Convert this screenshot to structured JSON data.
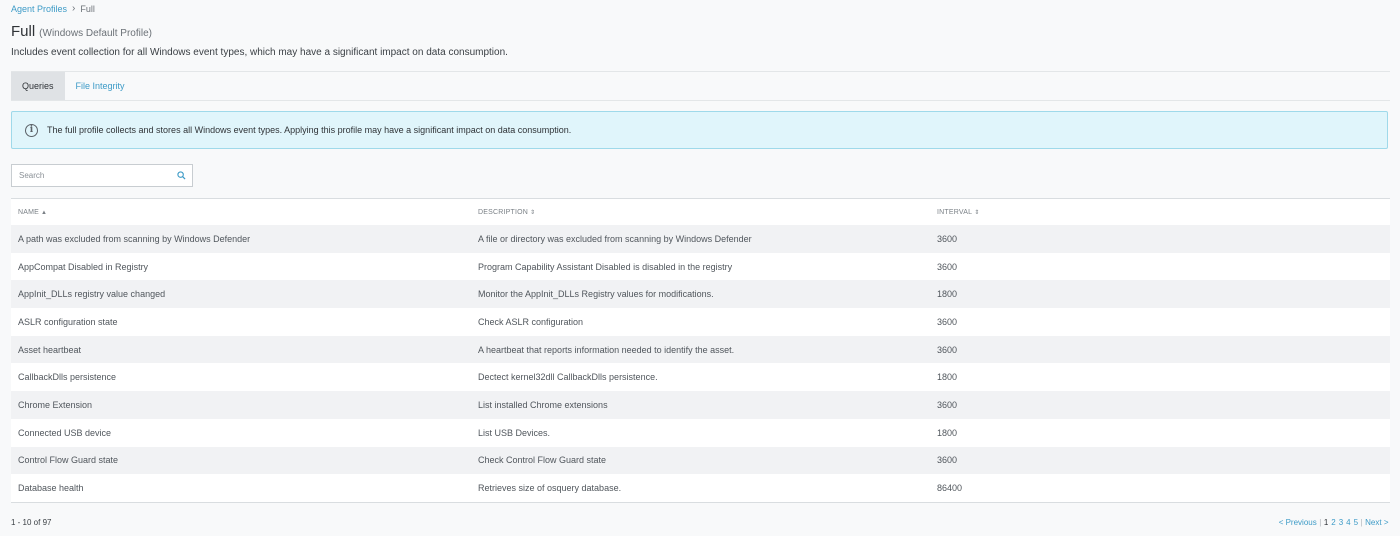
{
  "breadcrumb": {
    "parent": "Agent Profiles",
    "separator": "›",
    "current": "Full"
  },
  "page": {
    "title": "Full",
    "subtitle": "(Windows Default Profile)",
    "description": "Includes event collection for all Windows event types, which may have a significant impact on data consumption."
  },
  "tabs": [
    {
      "label": "Queries",
      "active": true
    },
    {
      "label": "File Integrity",
      "active": false
    }
  ],
  "alert": {
    "icon": "info-icon",
    "text": "The full profile collects and stores all Windows event types. Applying this profile may have a significant impact on data consumption."
  },
  "search": {
    "placeholder": "Search",
    "value": ""
  },
  "table": {
    "columns": [
      {
        "label": "NAME",
        "sort": "▲"
      },
      {
        "label": "DESCRIPTION",
        "sort": "⇕"
      },
      {
        "label": "INTERVAL",
        "sort": "⇕"
      }
    ],
    "rows": [
      {
        "name": "A path was excluded from scanning by Windows Defender",
        "description": "A file or directory was excluded from scanning by Windows Defender",
        "interval": "3600"
      },
      {
        "name": "AppCompat Disabled in Registry",
        "description": "Program Capability Assistant Disabled is disabled in the registry",
        "interval": "3600"
      },
      {
        "name": "AppInit_DLLs registry value changed",
        "description": "Monitor the AppInit_DLLs Registry values for modifications.",
        "interval": "1800"
      },
      {
        "name": "ASLR configuration state",
        "description": "Check ASLR configuration",
        "interval": "3600"
      },
      {
        "name": "Asset heartbeat",
        "description": "A heartbeat that reports information needed to identify the asset.",
        "interval": "3600"
      },
      {
        "name": "CallbackDlls persistence",
        "description": "Dectect kernel32dll CallbackDlls persistence.",
        "interval": "1800"
      },
      {
        "name": "Chrome Extension",
        "description": "List installed Chrome extensions",
        "interval": "3600"
      },
      {
        "name": "Connected USB device",
        "description": "List USB Devices.",
        "interval": "1800"
      },
      {
        "name": "Control Flow Guard state",
        "description": "Check Control Flow Guard state",
        "interval": "3600"
      },
      {
        "name": "Database health",
        "description": "Retrieves size of osquery database.",
        "interval": "86400"
      }
    ]
  },
  "footer": {
    "range": "1 - 10 of 97",
    "pagination": {
      "previous": "< Previous",
      "current": "1",
      "pages": [
        "2",
        "3",
        "4",
        "5"
      ],
      "next": "Next >"
    }
  }
}
